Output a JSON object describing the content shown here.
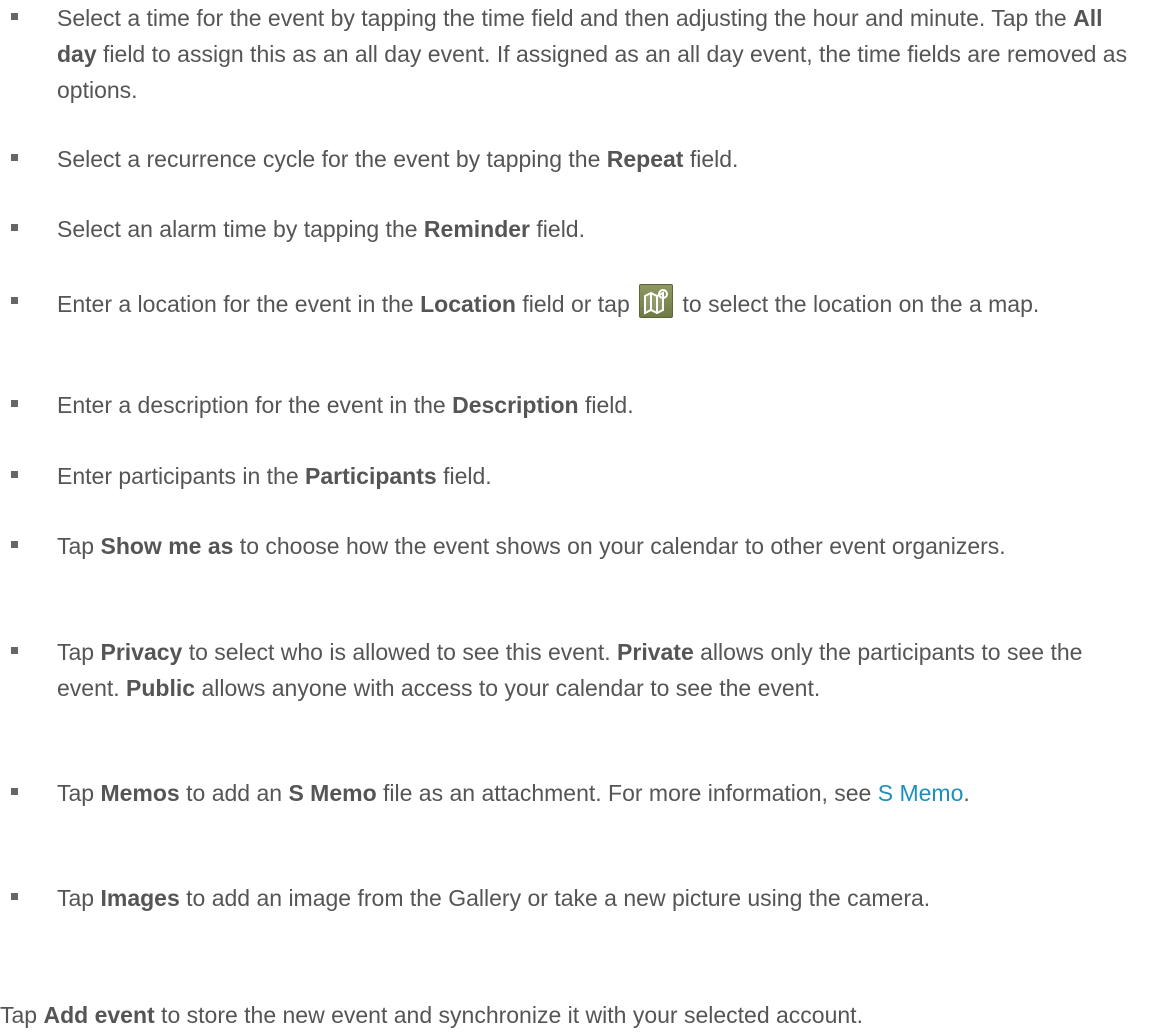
{
  "items": [
    {
      "parts": [
        {
          "t": "Select a time for the event by tapping the time field and then adjusting the hour and minute. Tap the "
        },
        {
          "t": "All day",
          "b": true
        },
        {
          "t": " field to assign this as an all day event. If assigned as an all day event, the time fields are removed as options."
        }
      ]
    },
    {
      "parts": [
        {
          "t": "Select a recurrence cycle for the event by tapping the "
        },
        {
          "t": "Repeat",
          "b": true
        },
        {
          "t": " field."
        }
      ]
    },
    {
      "parts": [
        {
          "t": "Select an alarm time by tapping the "
        },
        {
          "t": "Reminder",
          "b": true
        },
        {
          "t": " field."
        }
      ]
    },
    {
      "parts": [
        {
          "t": "Enter a location for the event in the "
        },
        {
          "t": "Location",
          "b": true
        },
        {
          "t": " field or tap "
        },
        {
          "icon": "map-pin-icon"
        },
        {
          "t": " to select the location on the a map."
        }
      ]
    },
    {
      "parts": [
        {
          "t": "Enter a description for the event in the "
        },
        {
          "t": "Description",
          "b": true
        },
        {
          "t": " field."
        }
      ]
    },
    {
      "parts": [
        {
          "t": "Enter participants in the "
        },
        {
          "t": "Participants",
          "b": true
        },
        {
          "t": " field."
        }
      ]
    },
    {
      "parts": [
        {
          "t": "Tap "
        },
        {
          "t": "Show me as",
          "b": true
        },
        {
          "t": " to choose how the event shows on your calendar to other event organizers."
        }
      ]
    },
    {
      "parts": [
        {
          "t": "Tap "
        },
        {
          "t": "Privacy",
          "b": true
        },
        {
          "t": " to select who is allowed to see this event. "
        },
        {
          "t": "Private",
          "b": true
        },
        {
          "t": " allows only the participants to see the event. "
        },
        {
          "t": "Public",
          "b": true
        },
        {
          "t": " allows anyone with access to your calendar to see the event."
        }
      ]
    },
    {
      "parts": [
        {
          "t": "Tap "
        },
        {
          "t": "Memos",
          "b": true
        },
        {
          "t": " to add an "
        },
        {
          "t": "S Memo",
          "b": true
        },
        {
          "t": " file as an attachment. For more information, see "
        },
        {
          "t": "S Memo",
          "link": true
        },
        {
          "t": "."
        }
      ]
    },
    {
      "parts": [
        {
          "t": "Tap "
        },
        {
          "t": "Images",
          "b": true
        },
        {
          "t": " to add an image from the Gallery or take a new picture using the camera."
        }
      ]
    }
  ],
  "footer": {
    "parts": [
      {
        "t": "Tap "
      },
      {
        "t": "Add event",
        "b": true
      },
      {
        "t": " to store the new event and synchronize it with your selected account."
      }
    ]
  }
}
